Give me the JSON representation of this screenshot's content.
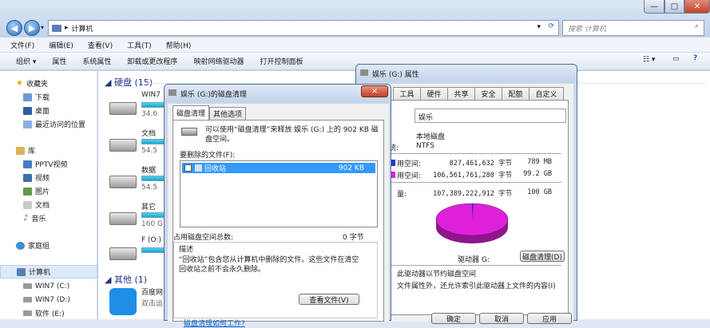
{
  "window": {
    "breadcrumb": "计算机",
    "search_placeholder": "搜索 计算机",
    "controls": {
      "min": "—",
      "max": "□",
      "close": "✕"
    }
  },
  "menu": [
    "文件(F)",
    "编辑(E)",
    "查看(V)",
    "工具(T)",
    "帮助(H)"
  ],
  "toolbar": [
    "组织 ▾",
    "属性",
    "系统属性",
    "卸载或更改程序",
    "映射网络驱动器",
    "打开控制面板"
  ],
  "sidebar": {
    "favorites": {
      "label": "收藏夹",
      "items": [
        "下载",
        "桌面",
        "最近访问的位置"
      ]
    },
    "library": {
      "label": "库",
      "items": [
        "PPTV视频",
        "视频",
        "图片",
        "文档",
        "音乐"
      ]
    },
    "homegroup": "家庭组",
    "computer": {
      "label": "计算机",
      "items": [
        "WIN7 (C:)",
        "WIN7 (D:)",
        "软件 (E:)"
      ]
    }
  },
  "content": {
    "hdd_group": "硬盘 (15)",
    "drives": [
      {
        "name": "WIN7",
        "sub": "34.6"
      },
      {
        "name": "文档",
        "sub": "54.5"
      },
      {
        "name": "数据",
        "sub": "54.5"
      },
      {
        "name": "其它",
        "sub": "160 G"
      },
      {
        "name": "F (O:)",
        "sub": ""
      }
    ],
    "other_group": "其他 (1)",
    "other_item": {
      "name": "百度网",
      "sub": "双击运"
    }
  },
  "properties_dialog": {
    "title": "娱乐 (G:) 属性",
    "tabs": [
      "工具",
      "硬件",
      "共享",
      "安全",
      "配额",
      "自定义"
    ],
    "name_value": "娱乐",
    "type_value": "本地磁盘",
    "fs_label": "统:",
    "fs_value": "NTFS",
    "used_label": "用空间:",
    "used_bytes": "827,461,632 字节",
    "used_size": "789 MB",
    "free_label": "用空间:",
    "free_bytes": "106,561,761,280 字节",
    "free_size": "99.2 GB",
    "cap_label": "量:",
    "cap_bytes": "107,389,222,912 字节",
    "cap_size": "100 GB",
    "drive_label": "驱动器 G:",
    "cleanup_button": "磁盘清理(D)",
    "compress_text": "此驱动器以节约磁盘空间",
    "index_text": "文件属性外，还允许索引此驱动器上文件的内容(I)",
    "ok": "确定",
    "cancel": "取消",
    "apply": "应用",
    "pie": {
      "used_fraction": 0.008,
      "used_color": "#1f3ad0",
      "free_color": "#e020d8"
    }
  },
  "cleanup_dialog": {
    "title": "娱乐 (G:)的磁盘清理",
    "tabs": [
      "磁盘清理",
      "其他选项"
    ],
    "intro": "可以使用“磁盘清理”来释放 娱乐 (G:) 上的 902 KB 磁盘空间。",
    "files_label": "要删除的文件(F):",
    "file_item": {
      "name": "回收站",
      "size": "902 KB"
    },
    "total_label": "占用磁盘空间总数:",
    "total_value": "0 字节",
    "desc_label": "描述",
    "desc_text": "“回收站”包含您从计算机中删除的文件。这些文件在清空回收站之前不会永久删除。",
    "view_button": "查看文件(V)",
    "footer_link": "磁盘清理如何工作?"
  }
}
